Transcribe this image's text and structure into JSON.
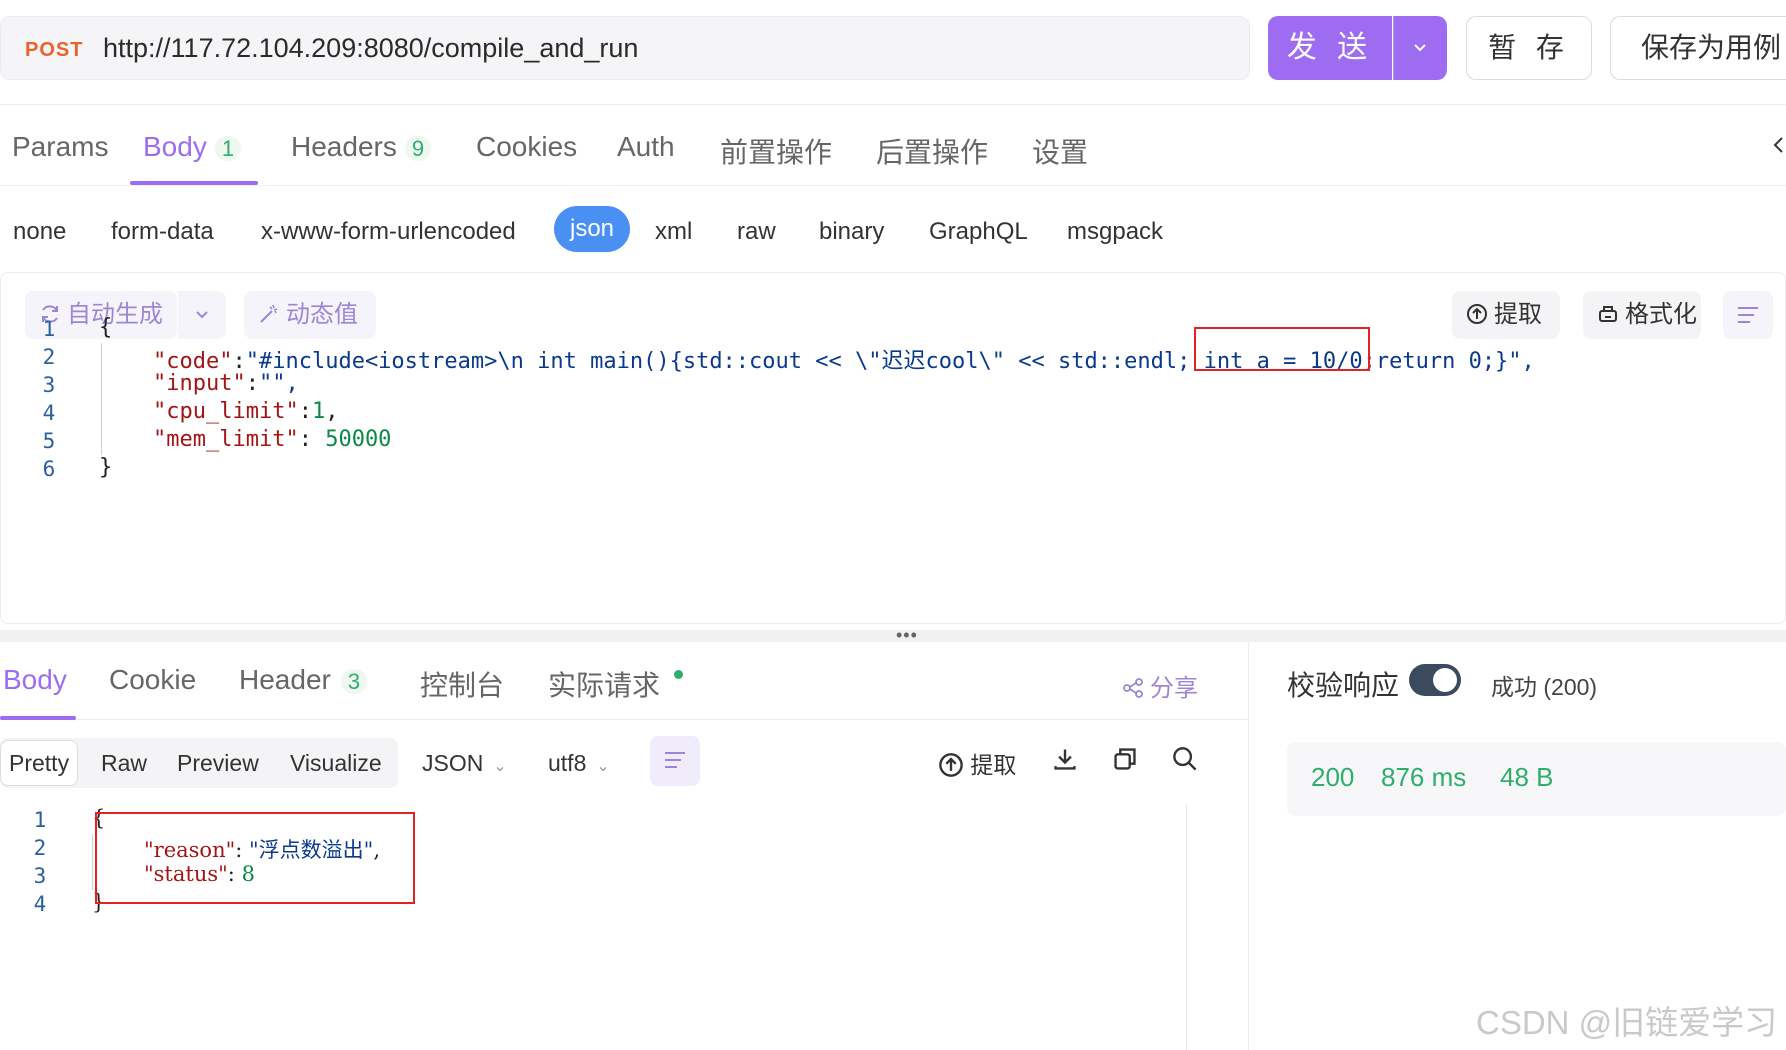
{
  "request": {
    "method": "POST",
    "url": "http://117.72.104.209:8080/compile_and_run",
    "send_label": "发 送",
    "save_label": "暂 存",
    "save_case_label": "保存为用例"
  },
  "request_tabs": [
    {
      "label": "Params"
    },
    {
      "label": "Body",
      "count": "1"
    },
    {
      "label": "Headers",
      "count": "9"
    },
    {
      "label": "Cookies"
    },
    {
      "label": "Auth"
    },
    {
      "label": "前置操作"
    },
    {
      "label": "后置操作"
    },
    {
      "label": "设置"
    }
  ],
  "body_types": [
    "none",
    "form-data",
    "x-www-form-urlencoded",
    "json",
    "xml",
    "raw",
    "binary",
    "GraphQL",
    "msgpack"
  ],
  "body_type_selected": "json",
  "editor_toolbar": {
    "auto_generate": "自动生成",
    "dynamic_value": "动态值",
    "extract": "提取",
    "format": "格式化"
  },
  "request_body": {
    "line_numbers": [
      "1",
      "2",
      "3",
      "4",
      "5",
      "6"
    ],
    "open_brace": "{",
    "code_key": "\"code\"",
    "code_val_pre": "\"#include<iostream>\\n int main(){std::cout << \\\"迟迟cool\\\" << std::endl; ",
    "code_val_hl": "int a = 10/0",
    "code_val_post": ";return 0;}\",",
    "input_key": "\"input\"",
    "input_val": "\"\",",
    "cpu_key": "\"cpu_limit\"",
    "cpu_val": "1",
    "mem_key": "\"mem_limit\"",
    "mem_val": "50000",
    "close_brace": "}"
  },
  "response_tabs": [
    {
      "label": "Body"
    },
    {
      "label": "Cookie"
    },
    {
      "label": "Header",
      "count": "3"
    },
    {
      "label": "控制台"
    },
    {
      "label": "实际请求"
    }
  ],
  "share_label": "分享",
  "view_modes": [
    "Pretty",
    "Raw",
    "Preview",
    "Visualize"
  ],
  "view_mode_selected": "Pretty",
  "format_select": "JSON",
  "encoding_select": "utf8",
  "response_extract": "提取",
  "response_body": {
    "line_numbers": [
      "1",
      "2",
      "3",
      "4"
    ],
    "open_brace": "{",
    "reason_key": "\"reason\"",
    "reason_val": "\"浮点数溢出\"",
    "status_key": "\"status\"",
    "status_val": "8",
    "close_brace": "}"
  },
  "response_meta": {
    "verify_label": "校验响应",
    "verify_enabled": true,
    "status_text": "成功 (200)",
    "code": "200",
    "time": "876 ms",
    "size": "48 B"
  },
  "watermark": "CSDN @旧链爱学习",
  "colors": {
    "accent": "#9d6cf0",
    "method": "#e8632d",
    "success": "#2eae6a",
    "json_active": "#4a8ff2",
    "highlight_box": "#e02424"
  }
}
